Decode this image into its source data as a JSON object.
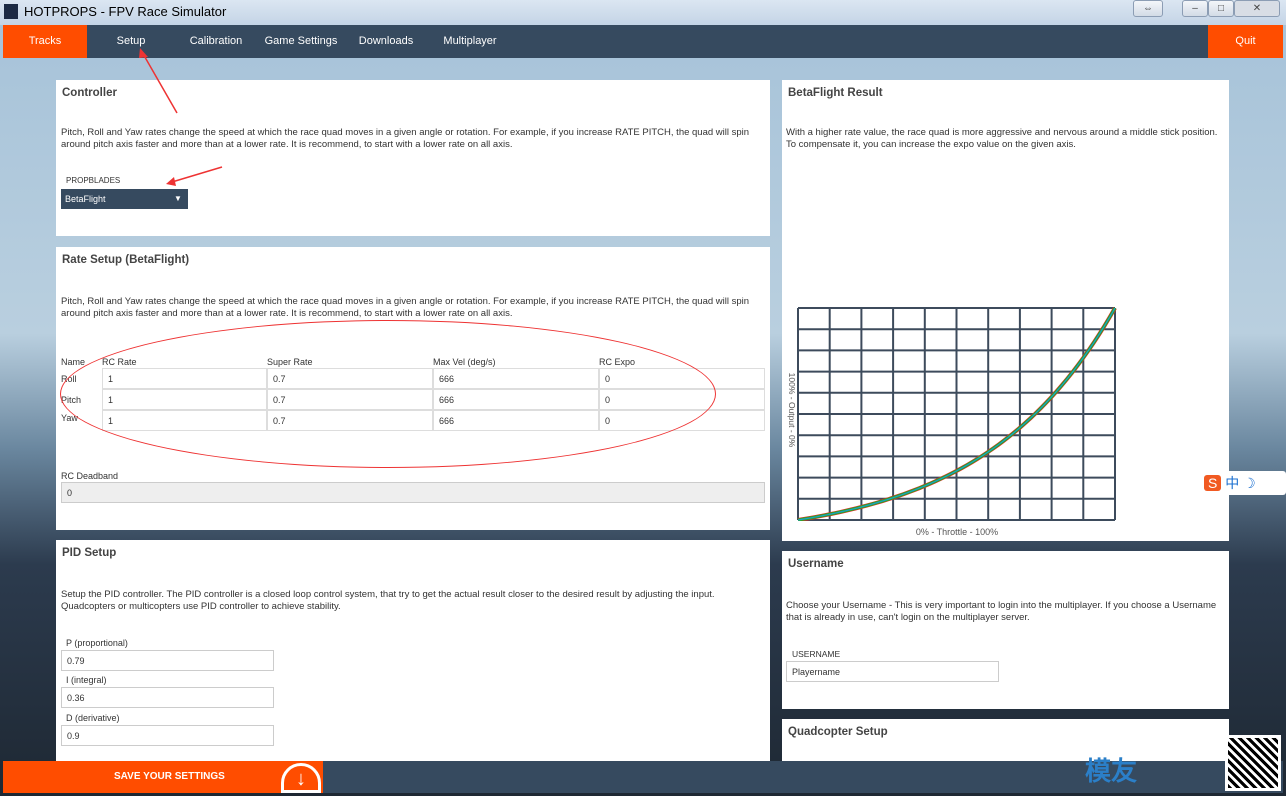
{
  "window": {
    "title": "HOTPROPS - FPV Race Simulator"
  },
  "nav": {
    "items": [
      {
        "label": "Tracks",
        "active": true
      },
      {
        "label": "Setup"
      },
      {
        "label": "Calibration"
      },
      {
        "label": "Game Settings"
      },
      {
        "label": "Downloads"
      },
      {
        "label": "Multiplayer"
      }
    ],
    "quit": "Quit"
  },
  "controller": {
    "title": "Controller",
    "desc": "Pitch, Roll and Yaw rates change the speed at which the race quad moves in a given angle or rotation. For example, if you increase RATE PITCH, the quad will spin around pitch axis faster and more than at a lower rate. It is recommend, to start with a lower rate on all axis.",
    "propblades_label": "PROPBLADES",
    "propblades_value": "BetaFlight"
  },
  "rate": {
    "title": "Rate Setup (BetaFlight)",
    "desc": "Pitch, Roll and Yaw rates change the speed at which the race quad moves in a given angle or rotation. For example, if you increase RATE PITCH, the quad will spin around pitch axis faster and more than at a lower rate. It is recommend, to start with a lower rate on all axis.",
    "headers": [
      "Name",
      "RC Rate",
      "Super Rate",
      "Max Vel (deg/s)",
      "RC Expo"
    ],
    "rows": [
      [
        "Roll",
        "1",
        "0.7",
        "666",
        "0"
      ],
      [
        "Pitch",
        "1",
        "0.7",
        "666",
        "0"
      ],
      [
        "Yaw",
        "1",
        "0.7",
        "666",
        "0"
      ]
    ],
    "deadband_label": "RC Deadband",
    "deadband_value": "0"
  },
  "pid": {
    "title": "PID Setup",
    "desc": "Setup the PID controller. The PID controller is a closed loop control system,  that try to get the actual result closer to the desired result by adjusting the input. Quadcopters or multicopters use PID controller to achieve stability.",
    "p_label": "P (proportional)",
    "p_value": "0.79",
    "i_label": "I (integral)",
    "i_value": "0.36",
    "d_label": "D (derivative)",
    "d_value": "0.9"
  },
  "result": {
    "title": "BetaFlight Result",
    "desc": "With a higher rate value, the race quad is more aggressive and nervous around a middle stick position. To compensate it, you can increase the expo value on the given axis.",
    "ylabel": "100% - Output - 0%",
    "xlabel": "0% - Throttle - 100%"
  },
  "username": {
    "title": "Username",
    "desc": "Choose your Username - This is very important to login into the multiplayer. If you choose a Username that is already in use, can't login on the multiplayer server.",
    "label": "USERNAME",
    "value": "Playername"
  },
  "quad": {
    "title": "Quadcopter Setup"
  },
  "footer": {
    "save": "SAVE YOUR SETTINGS"
  },
  "colors": {
    "accent": "#ff4d00",
    "nav": "#364a5f"
  }
}
